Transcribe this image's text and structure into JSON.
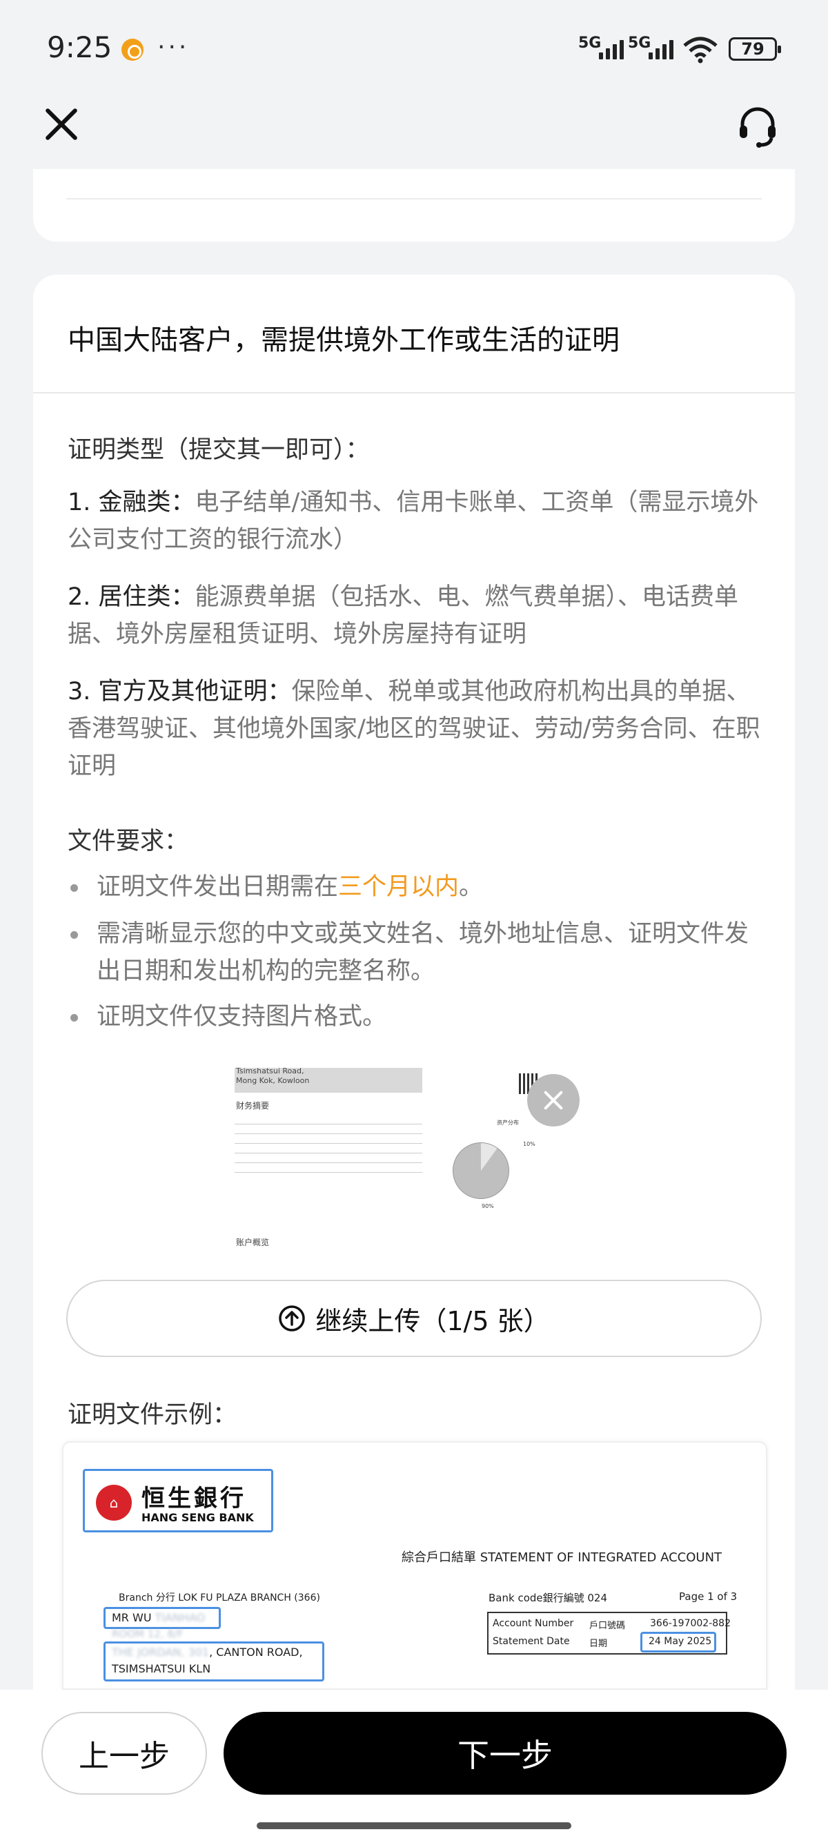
{
  "status_bar": {
    "time": "9:25",
    "more": "···",
    "network_1": "5G",
    "network_2": "5G",
    "battery": "79"
  },
  "icons": {
    "close": "close-icon",
    "support": "headset-icon",
    "upload": "upload-icon",
    "remove": "close-icon"
  },
  "section": {
    "heading": "中国大陆客户，需提供境外工作或生活的证明",
    "proof_types_title": "证明类型（提交其一即可）：",
    "types": [
      {
        "label": "1. 金融类：",
        "text": "电子结单/通知书、信用卡账单、工资单（需显示境外公司支付工资的银行流水）"
      },
      {
        "label": "2. 居住类：",
        "text": "能源费单据（包括水、电、燃气费单据）、电话费单据、境外房屋租赁证明、境外房屋持有证明"
      },
      {
        "label": "3. 官方及其他证明：",
        "text": "保险单、税单或其他政府机构出具的单据、香港驾驶证、其他境外国家/地区的驾驶证、劳动/劳务合同、在职证明"
      }
    ],
    "requirements_title": "文件要求：",
    "req1_before": "证明文件发出日期需在",
    "req1_highlight": "三个月以内",
    "req1_after": "。",
    "req2": "需清晰显示您的中文或英文姓名、境外地址信息、证明文件发出日期和发出机构的完整名称。",
    "req3": "证明文件仅支持图片格式。"
  },
  "preview": {
    "addr1": "Tsimshatsui Road,",
    "addr2": "Mong Kok, Kowloon",
    "summary": "财务摘要",
    "overview": "账户概览",
    "pie_label_1": "资产分布",
    "pie_label_2": "10%",
    "pie_label_3": "90%"
  },
  "upload_button": "继续上传（1/5 张）",
  "example_title": "证明文件示例：",
  "sample": {
    "bank_cn": "恒生銀行",
    "bank_en": "HANG SENG BANK",
    "statement_title": "綜合戶口結單  STATEMENT OF INTEGRATED ACCOUNT",
    "branch": "Branch 分行  LOK FU PLAZA BRANCH (366)",
    "name": "MR WU",
    "name_blur": "TIANHAO",
    "addr_blur_1": "ROOM 12, 8/F",
    "addr_blur_2": "THE JORDAN, 301",
    "addr_end": ", CANTON ROAD,",
    "addr_city": "TSIMSHATSUI KLN",
    "bank_code": "Bank code銀行編號 024",
    "page": "Page 1 of 3",
    "acct_label": "Account Number",
    "acct_label_cn": "戶口號碼",
    "acct_number": "366-197002-882",
    "date_label": "Statement Date",
    "date_label_cn": "日期",
    "date": "24 May 2025"
  },
  "nav": {
    "prev": "上一步",
    "next": "下一步"
  },
  "colors": {
    "accent": "#f39a1e",
    "primary_button": "#000000",
    "highlight_box": "#4a90e2",
    "bank_red": "#d8232a"
  }
}
